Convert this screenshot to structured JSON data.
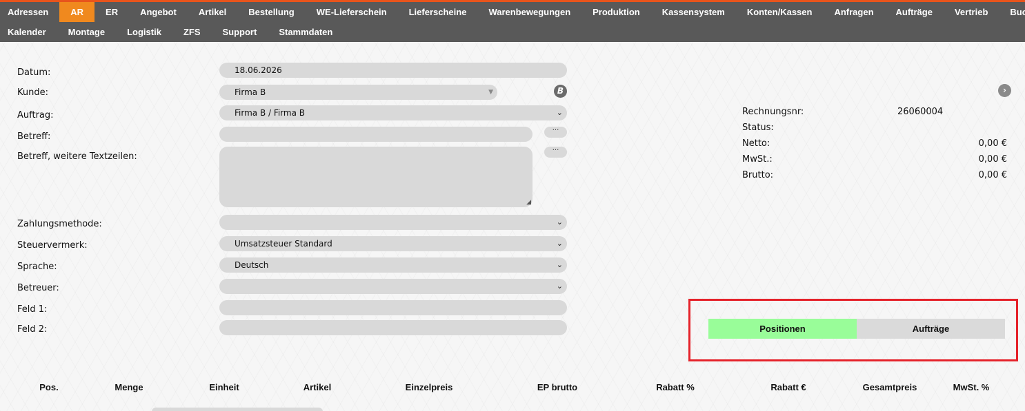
{
  "nav": {
    "row1": [
      "Adressen",
      "AR",
      "ER",
      "Angebot",
      "Artikel",
      "Bestellung",
      "WE-Lieferschein",
      "Lieferscheine",
      "Warenbewegungen",
      "Produktion",
      "Kassensystem",
      "Konten/Kassen",
      "Anfragen",
      "Aufträge",
      "Vertrieb",
      "Buchhaltung"
    ],
    "row2": [
      "Kalender",
      "Montage",
      "Logistik",
      "ZFS",
      "Support",
      "Stammdaten"
    ],
    "active": "AR"
  },
  "form": {
    "datum_label": "Datum:",
    "datum_value": "18.06.2026",
    "kunde_label": "Kunde:",
    "kunde_value": "Firma B",
    "auftrag_label": "Auftrag:",
    "auftrag_value": "Firma B / Firma B",
    "betreff_label": "Betreff:",
    "betreff_value": "",
    "betreff_weitere_label": "Betreff, weitere Textzeilen:",
    "zahlungsmethode_label": "Zahlungsmethode:",
    "zahlungsmethode_value": "",
    "steuervermerk_label": "Steuervermerk:",
    "steuervermerk_value": "Umsatzsteuer Standard",
    "sprache_label": "Sprache:",
    "sprache_value": "Deutsch",
    "betreuer_label": "Betreuer:",
    "betreuer_value": "",
    "feld1_label": "Feld 1:",
    "feld1_value": "",
    "feld2_label": "Feld 2:",
    "feld2_value": "",
    "dots": "···",
    "kunde_badge": "B"
  },
  "info": {
    "rechnungsnr_label": "Rechnungsnr:",
    "rechnungsnr_value": "26060004",
    "status_label": "Status:",
    "status_value": "",
    "netto_label": "Netto:",
    "netto_value": "0,00 €",
    "mwst_label": "MwSt.:",
    "mwst_value": "0,00 €",
    "brutto_label": "Brutto:",
    "brutto_value": "0,00 €"
  },
  "tabs": {
    "positionen": "Positionen",
    "auftraege": "Aufträge"
  },
  "table": {
    "headers": [
      "Pos.",
      "Menge",
      "Einheit",
      "Artikel",
      "Einzelpreis",
      "EP brutto",
      "Rabatt %",
      "Rabatt €",
      "Gesamtpreis",
      "MwSt. %"
    ]
  },
  "colors": {
    "accent": "#f0891e",
    "nav_bg": "#595959",
    "tab_active": "#99fd99",
    "highlight": "#e5222a"
  }
}
